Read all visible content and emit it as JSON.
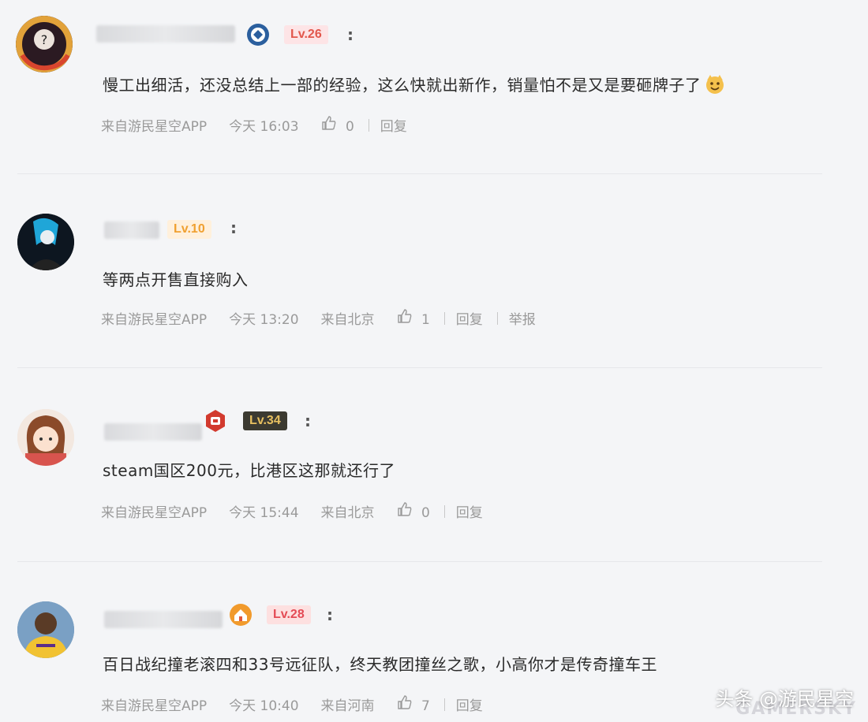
{
  "comments": [
    {
      "level": "Lv.26",
      "more": ":",
      "text": "慢工出细活，还没总结上一部的经验，这么快就出新作，销量怕不是又是要砸牌子了",
      "emoji_icon": "grinning-cat-icon",
      "source": "来自游民星空APP",
      "time": "今天 16:03",
      "likes": "0",
      "reply": "回复"
    },
    {
      "level": "Lv.10",
      "more": ":",
      "text": "等两点开售直接购入",
      "source": "来自游民星空APP",
      "time": "今天 13:20",
      "location": "来自北京",
      "likes": "1",
      "reply": "回复",
      "report": "举报"
    },
    {
      "level": "Lv.34",
      "more": ":",
      "text": "steam国区200元，比港区这那就还行了",
      "source": "来自游民星空APP",
      "time": "今天 15:44",
      "location": "来自北京",
      "likes": "0",
      "reply": "回复"
    },
    {
      "level": "Lv.28",
      "more": ":",
      "text": "百日战纪撞老滚四和33号远征队，终天教团撞丝之歌，小高你才是传奇撞车王",
      "source": "来自游民星空APP",
      "time": "今天 10:40",
      "location": "来自河南",
      "likes": "7",
      "reply": "回复"
    }
  ],
  "watermark": "头条 @游民星空",
  "watermark_faint": "GAMERSKY",
  "colors": {
    "background": "#f4f5f7",
    "meta_text": "#9a9a9a",
    "level_pink": "#e2574c",
    "level_orange": "#f0a030",
    "level_dark_bg": "#3c3a31"
  }
}
